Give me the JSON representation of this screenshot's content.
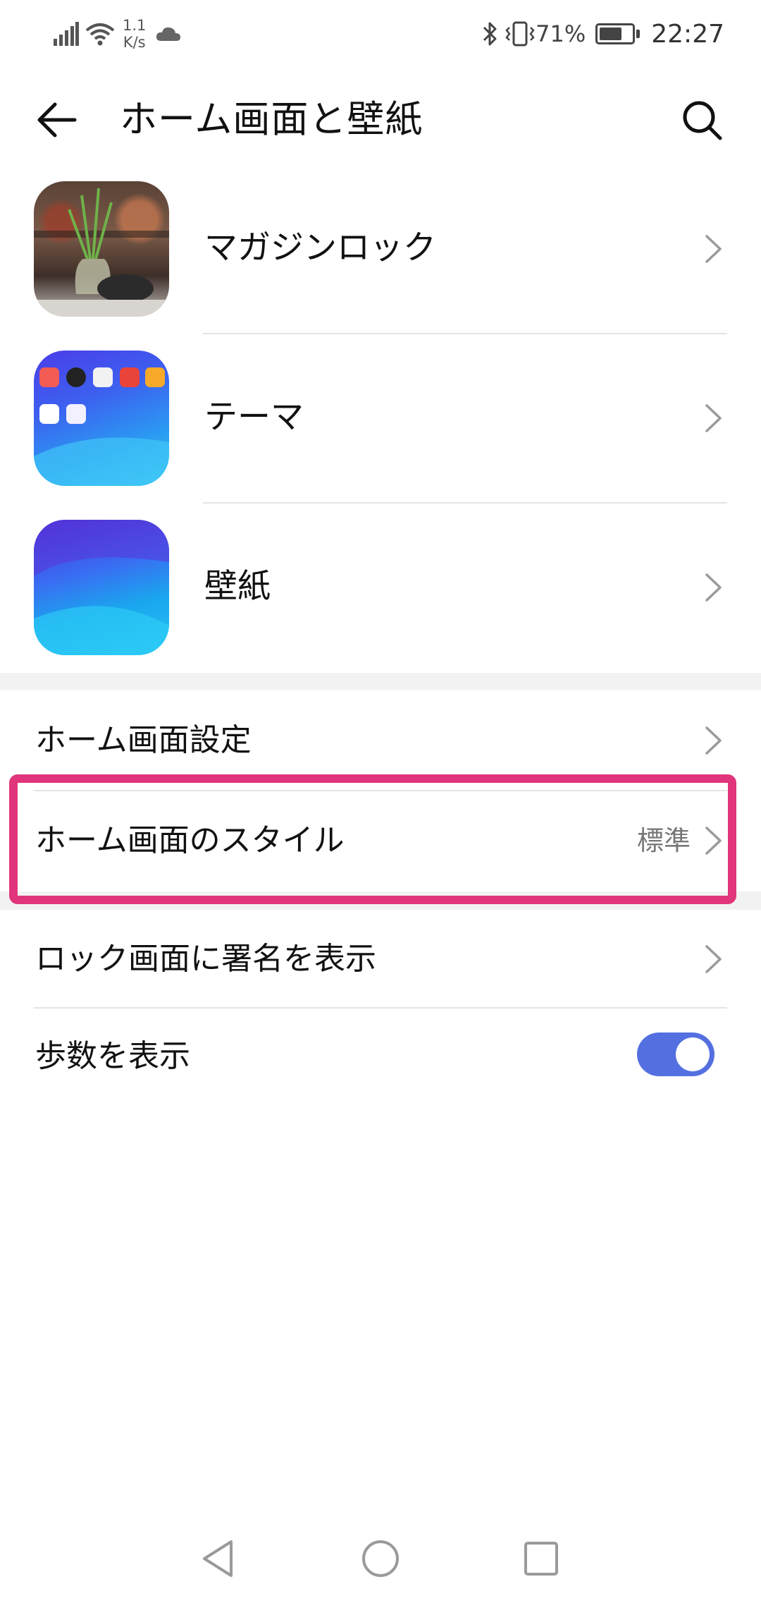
{
  "status_bar": {
    "net_speed_value": "1.1",
    "net_speed_unit": "K/s",
    "battery_percent": "71%",
    "battery_level": 0.71,
    "time": "22:27",
    "icons": [
      "signal-icon",
      "wifi-icon",
      "cloud-icon",
      "bluetooth-icon",
      "vibrate-icon",
      "battery-icon"
    ]
  },
  "header": {
    "title": "ホーム画面と壁紙",
    "back_icon": "back-arrow-icon",
    "search_icon": "search-icon"
  },
  "thumbnail_items": [
    {
      "label": "マガジンロック",
      "thumb": "magazine-lock-thumbnail"
    },
    {
      "label": "テーマ",
      "thumb": "theme-thumbnail"
    },
    {
      "label": "壁紙",
      "thumb": "wallpaper-thumbnail"
    }
  ],
  "theme_thumb_icons": [
    "#f25c54",
    "#222222",
    "#f2f2f2",
    "#e8443a",
    "#f7a92a",
    "#ffffff",
    "#f3f0ff",
    "#4b7bec"
  ],
  "settings_group_1": [
    {
      "label": "ホーム画面設定",
      "value": ""
    },
    {
      "label": "ホーム画面のスタイル",
      "value": "標準",
      "highlighted": true
    }
  ],
  "settings_group_2": [
    {
      "label": "ロック画面に署名を表示",
      "value": ""
    },
    {
      "label": "歩数を表示",
      "toggle": true,
      "toggle_on": true
    }
  ],
  "colors": {
    "highlight": "#e0357a",
    "toggle_on": "#5470e0",
    "section_gap": "#f2f2f2",
    "divider": "#e4e4e4"
  },
  "nav_bar": {
    "icons": [
      "nav-back-icon",
      "nav-home-icon",
      "nav-recents-icon"
    ]
  }
}
